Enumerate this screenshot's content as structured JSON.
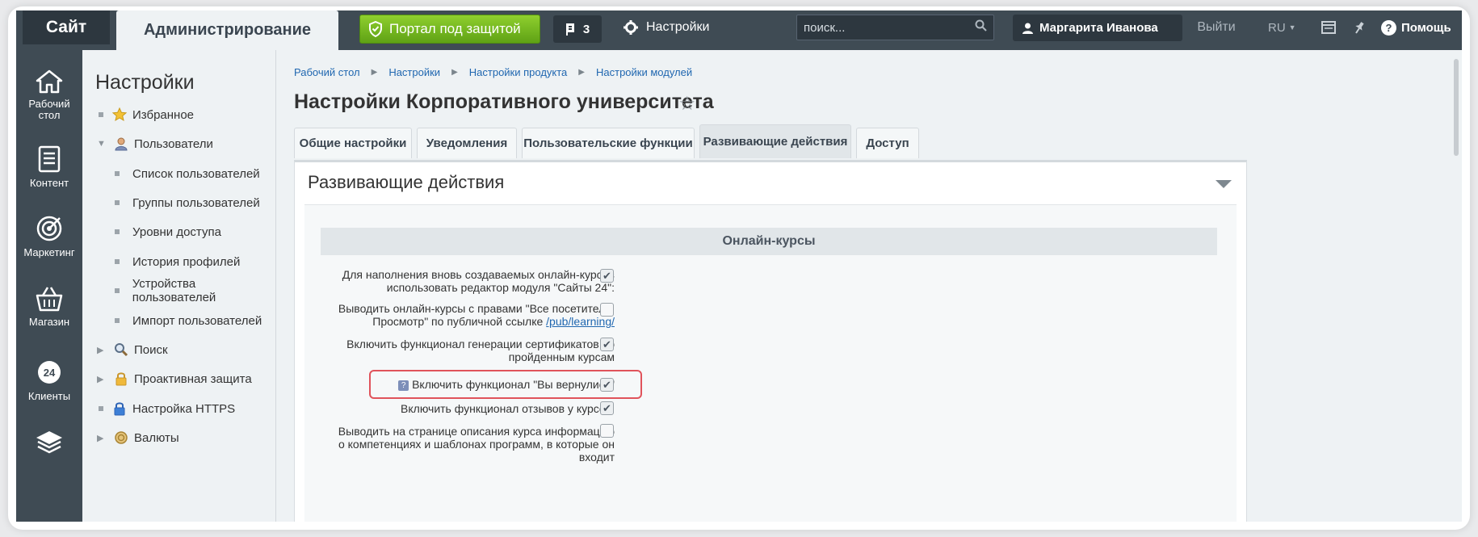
{
  "topbar": {
    "site": "Сайт",
    "admin": "Администрирование",
    "protected_label": "Портал под защитой",
    "notifications_count": "3",
    "settings_label": "Настройки",
    "search_placeholder": "поиск...",
    "user_name": "Маргарита Иванова",
    "logout": "Выйти",
    "lang": "RU",
    "help": "Помощь"
  },
  "rail": {
    "items": [
      {
        "label": "Рабочий стол",
        "icon": "home-icon"
      },
      {
        "label": "Контент",
        "icon": "document-icon"
      },
      {
        "label": "Маркетинг",
        "icon": "target-icon"
      },
      {
        "label": "Магазин",
        "icon": "basket-icon"
      },
      {
        "label": "Клиенты",
        "icon": "clients-24-icon"
      },
      {
        "label": "",
        "icon": "layers-icon"
      }
    ]
  },
  "sidebar": {
    "title": "Настройки",
    "items": [
      {
        "label": "Избранное"
      },
      {
        "label": "Пользователи"
      },
      {
        "label": "Список пользователей"
      },
      {
        "label": "Группы пользователей"
      },
      {
        "label": "Уровни доступа"
      },
      {
        "label": "История профилей"
      },
      {
        "label": "Устройства пользователей"
      },
      {
        "label": "Импорт пользователей"
      },
      {
        "label": "Поиск"
      },
      {
        "label": "Проактивная защита"
      },
      {
        "label": "Настройка HTTPS"
      },
      {
        "label": "Валюты"
      }
    ]
  },
  "breadcrumb": [
    "Рабочий стол",
    "Настройки",
    "Настройки продукта",
    "Настройки модулей"
  ],
  "page": {
    "title": "Настройки Корпоративного университета"
  },
  "tabs": [
    {
      "label": "Общие настройки"
    },
    {
      "label": "Уведомления"
    },
    {
      "label": "Пользовательские функции"
    },
    {
      "label": "Развивающие действия"
    },
    {
      "label": "Доступ"
    }
  ],
  "panel": {
    "title": "Развивающие действия",
    "section": "Онлайн-курсы",
    "options": [
      {
        "line1": "Для наполнения вновь создаваемых онлайн-курсов",
        "line2": "использовать редактор модуля \"Сайты 24\":",
        "checked": true
      },
      {
        "line1": "Выводить онлайн-курсы с правами \"Все посетители:",
        "line2": "Просмотр\" по публичной ссылке",
        "link": "/pub/learning/",
        "checked": false
      },
      {
        "line1": "Включить функционал генерации сертификатов по",
        "line2": "пройденным курсам",
        "checked": true
      },
      {
        "line1": "Включить функционал \"Вы вернулись\"",
        "checked": true
      },
      {
        "line1": "Включить функционал отзывов у курсов:",
        "checked": true
      },
      {
        "line1": "Выводить на странице описания курса информацию",
        "line2": "о компетенциях и шаблонах программ, в которые он",
        "line3": "входит",
        "checked": false
      }
    ]
  }
}
